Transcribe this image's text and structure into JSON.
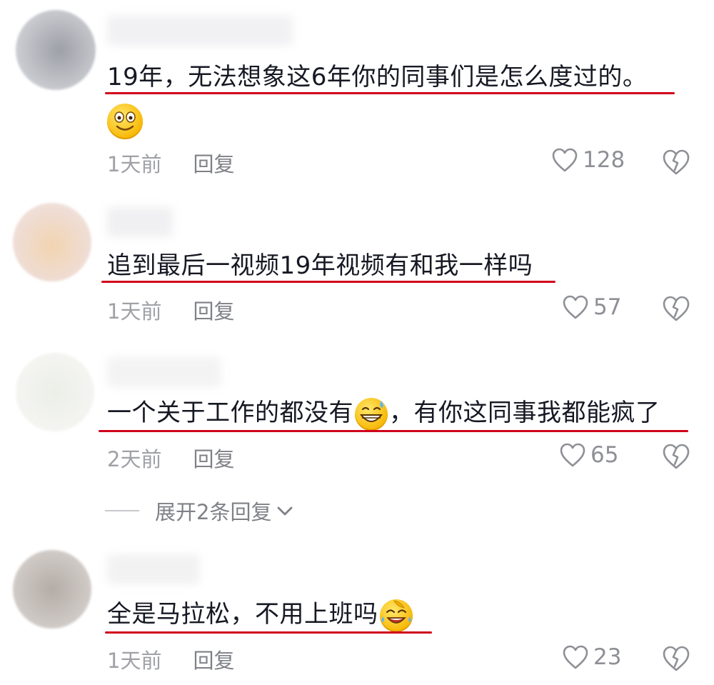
{
  "comments": [
    {
      "text": "19年，无法想象这6年你的同事们是怎么度过的。",
      "emoji": "smiling-face-emoji",
      "time": "1天前",
      "reply_label": "回复",
      "likes": "128"
    },
    {
      "text": "追到最后一视频19年视频有和我一样吗",
      "time": "1天前",
      "reply_label": "回复",
      "likes": "57"
    },
    {
      "text_before": "一个关于工作的都没有",
      "emoji": "grinning-sweat-emoji",
      "text_after": "，有你这同事我都能疯了",
      "time": "2天前",
      "reply_label": "回复",
      "likes": "65"
    },
    {
      "text_before": "全是马拉松，不用上班吗",
      "emoji": "facepalm-laugh-emoji",
      "time": "1天前",
      "reply_label": "回复",
      "likes": "23"
    }
  ],
  "expand_replies": "展开2条回复",
  "colors": {
    "underline": "#d0021b",
    "meta_text": "#9fa1a6",
    "icon": "#8e9096"
  }
}
